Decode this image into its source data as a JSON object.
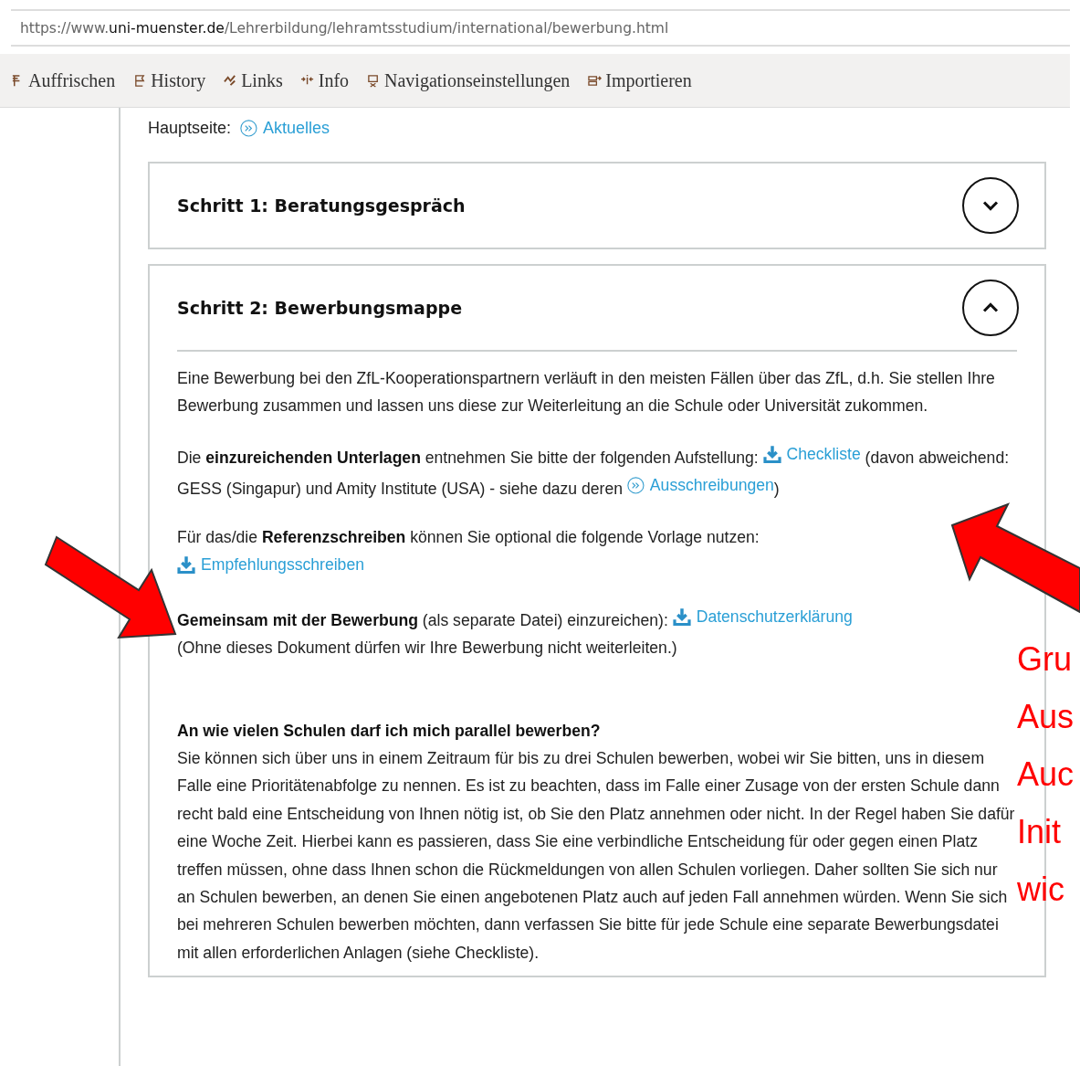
{
  "address_bar": {
    "url": "https://www.**uni-muenster.de**/Lehrerbildung/lehramtsstudium/international/bewerbung.html"
  },
  "toolbar": [
    {
      "label": "Auffrischen"
    },
    {
      "label": "History"
    },
    {
      "label": "Links"
    },
    {
      "label": "Info"
    },
    {
      "label": "Navigationseinstellungen"
    },
    {
      "label": "Importieren"
    }
  ],
  "intro": {
    "label": "Hauptseite:",
    "link": "Aktuelles"
  },
  "accordion": [
    {
      "title": "Schritt 1: Beratungsgespräch",
      "expanded": false
    },
    {
      "title": "Schritt 2: Bewerbungsmappe",
      "expanded": true,
      "paragraphs": [
        [
          {
            "kind": "text",
            "text": "Eine Bewerbung bei den ZfL-Kooperationspartnern verläuft in den meisten Fällen über das ZfL, d.h. Sie stellen Ihre Bewerbung zusammen und lassen uns diese zur Weiterleitung an die Schule oder Universität zukommen."
          }
        ],
        [
          {
            "kind": "text",
            "text": "Die **einzureichenden Unterlagen** entnehmen Sie bitte der folgenden Aufstellung: "
          },
          {
            "kind": "download",
            "text": "Checkliste"
          },
          {
            "kind": "text",
            "text": " (davon abweichend:  GESS (Singapur) und Amity Institute (USA) - siehe dazu deren "
          },
          {
            "kind": "link",
            "text": "Ausschreibungen"
          },
          {
            "kind": "text",
            "text": ")"
          }
        ],
        [
          {
            "kind": "text",
            "text": "Für das/die **Referenzschreiben** können Sie optional die folgende Vorlage nutzen:"
          },
          {
            "kind": "break"
          },
          {
            "kind": "download",
            "text": "Empfehlungsschreiben"
          }
        ],
        [
          {
            "kind": "text",
            "text": "**Gemeinsam mit der Bewerbung** (als separate Datei) einzureichen): "
          },
          {
            "kind": "download",
            "text": "Datenschutzerklärung"
          },
          {
            "kind": "break"
          },
          {
            "kind": "text",
            "text": "(Ohne dieses Dokument dürfen wir Ihre Bewerbung nicht weiterleiten.)"
          }
        ]
      ],
      "faq": {
        "question": "An wie vielen Schulen darf ich mich parallel bewerben?",
        "answer": "Sie können sich über uns in einem Zeitraum für bis zu drei Schulen bewerben, wobei wir Sie bitten, uns in diesem Falle eine Prioritätenabfolge zu nennen. Es ist zu beachten, dass im Falle einer Zusage von der ersten Schule dann recht bald eine Entscheidung von Ihnen nötig ist, ob Sie den Platz annehmen oder nicht. In der Regel haben Sie dafür eine Woche Zeit. Hierbei kann es passieren, dass Sie eine verbindliche Entscheidung für oder gegen einen Platz treffen müssen, ohne dass Ihnen schon die Rückmeldungen von allen Schulen vorliegen. Daher sollten Sie sich nur an Schulen bewerben, an denen Sie einen angebotenen Platz auch auf jeden Fall annehmen würden. Wenn Sie sich bei mehreren Schulen bewerben möchten, dann verfassen Sie bitte für jede Schule eine separate Bewerbungsdatei mit allen erforderlichen Anlagen (siehe Checkliste)."
      }
    }
  ],
  "annotation": {
    "lines": [
      "Gru",
      "Aus",
      "Auc",
      "Init",
      "wic"
    ]
  }
}
